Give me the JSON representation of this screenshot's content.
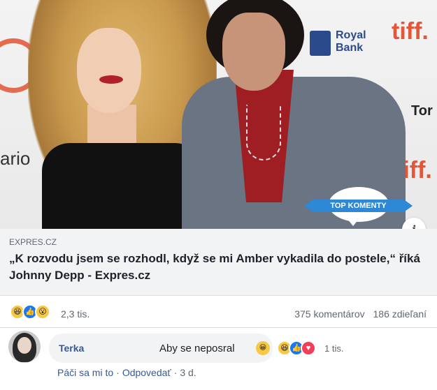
{
  "photo": {
    "bg_brands": {
      "tiff_1": "tiff",
      "tiff_2": "tiff.",
      "tiff_3": "tiff.",
      "rbc_line1": "Royal",
      "rbc_line2": "Bank",
      "ario": "ario",
      "tor": "Tor"
    },
    "badge_label": "TOP KOMENTY",
    "info_icon": "i"
  },
  "link": {
    "domain": "EXPRES.CZ",
    "title": "„K rozvodu jsem se rozhodl, když se mi Amber vykadila do postele,“ říká Johnny Depp - Expres.cz"
  },
  "stats": {
    "reaction_icons": [
      "haha-icon",
      "like-icon",
      "wow-icon"
    ],
    "reaction_count": "2,3 tis.",
    "comments": "375 komentárov",
    "shares": "186 zdieľaní"
  },
  "comment": {
    "author": "Terka",
    "text": "Aby se neposral",
    "reaction_icons": [
      "haha-icon",
      "like-icon",
      "love-icon"
    ],
    "reaction_count": "1 tis.",
    "like_action": "Páči sa mi to",
    "reply_action": "Odpovedať",
    "time": "3 d."
  },
  "colors": {
    "link": "#385898",
    "meta": "#606770",
    "badge": "#2d88d6",
    "card_bg": "#f2f3f5"
  }
}
